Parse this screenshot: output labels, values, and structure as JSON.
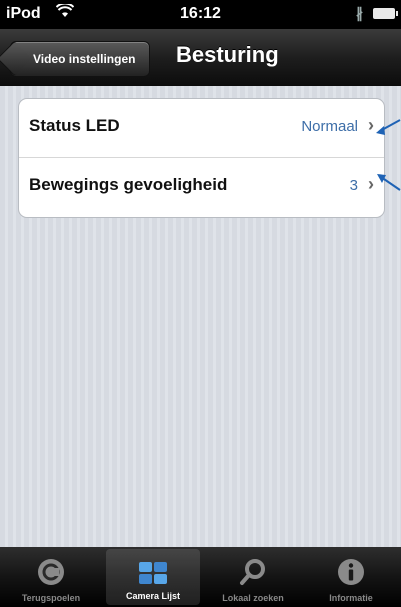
{
  "status_bar": {
    "carrier": "iPod",
    "wifi_icon": "wifi-icon",
    "time": "16:12",
    "bluetooth": "∦"
  },
  "nav": {
    "back_label": "Video instellingen",
    "title": "Besturing"
  },
  "settings": [
    {
      "label": "Status LED",
      "value": "Normaal"
    },
    {
      "label": "Bewegings gevoeligheid",
      "value": "3"
    }
  ],
  "colors": {
    "accent_value": "#3d6ea8",
    "annotation_arrow": "#1f63b5"
  },
  "tabs": [
    {
      "label": "Terugspoelen",
      "icon": "rewind-icon"
    },
    {
      "label": "Camera Lijst",
      "icon": "camera-list-icon",
      "active": true
    },
    {
      "label": "Lokaal zoeken",
      "icon": "search-icon"
    },
    {
      "label": "Informatie",
      "icon": "info-icon"
    }
  ]
}
